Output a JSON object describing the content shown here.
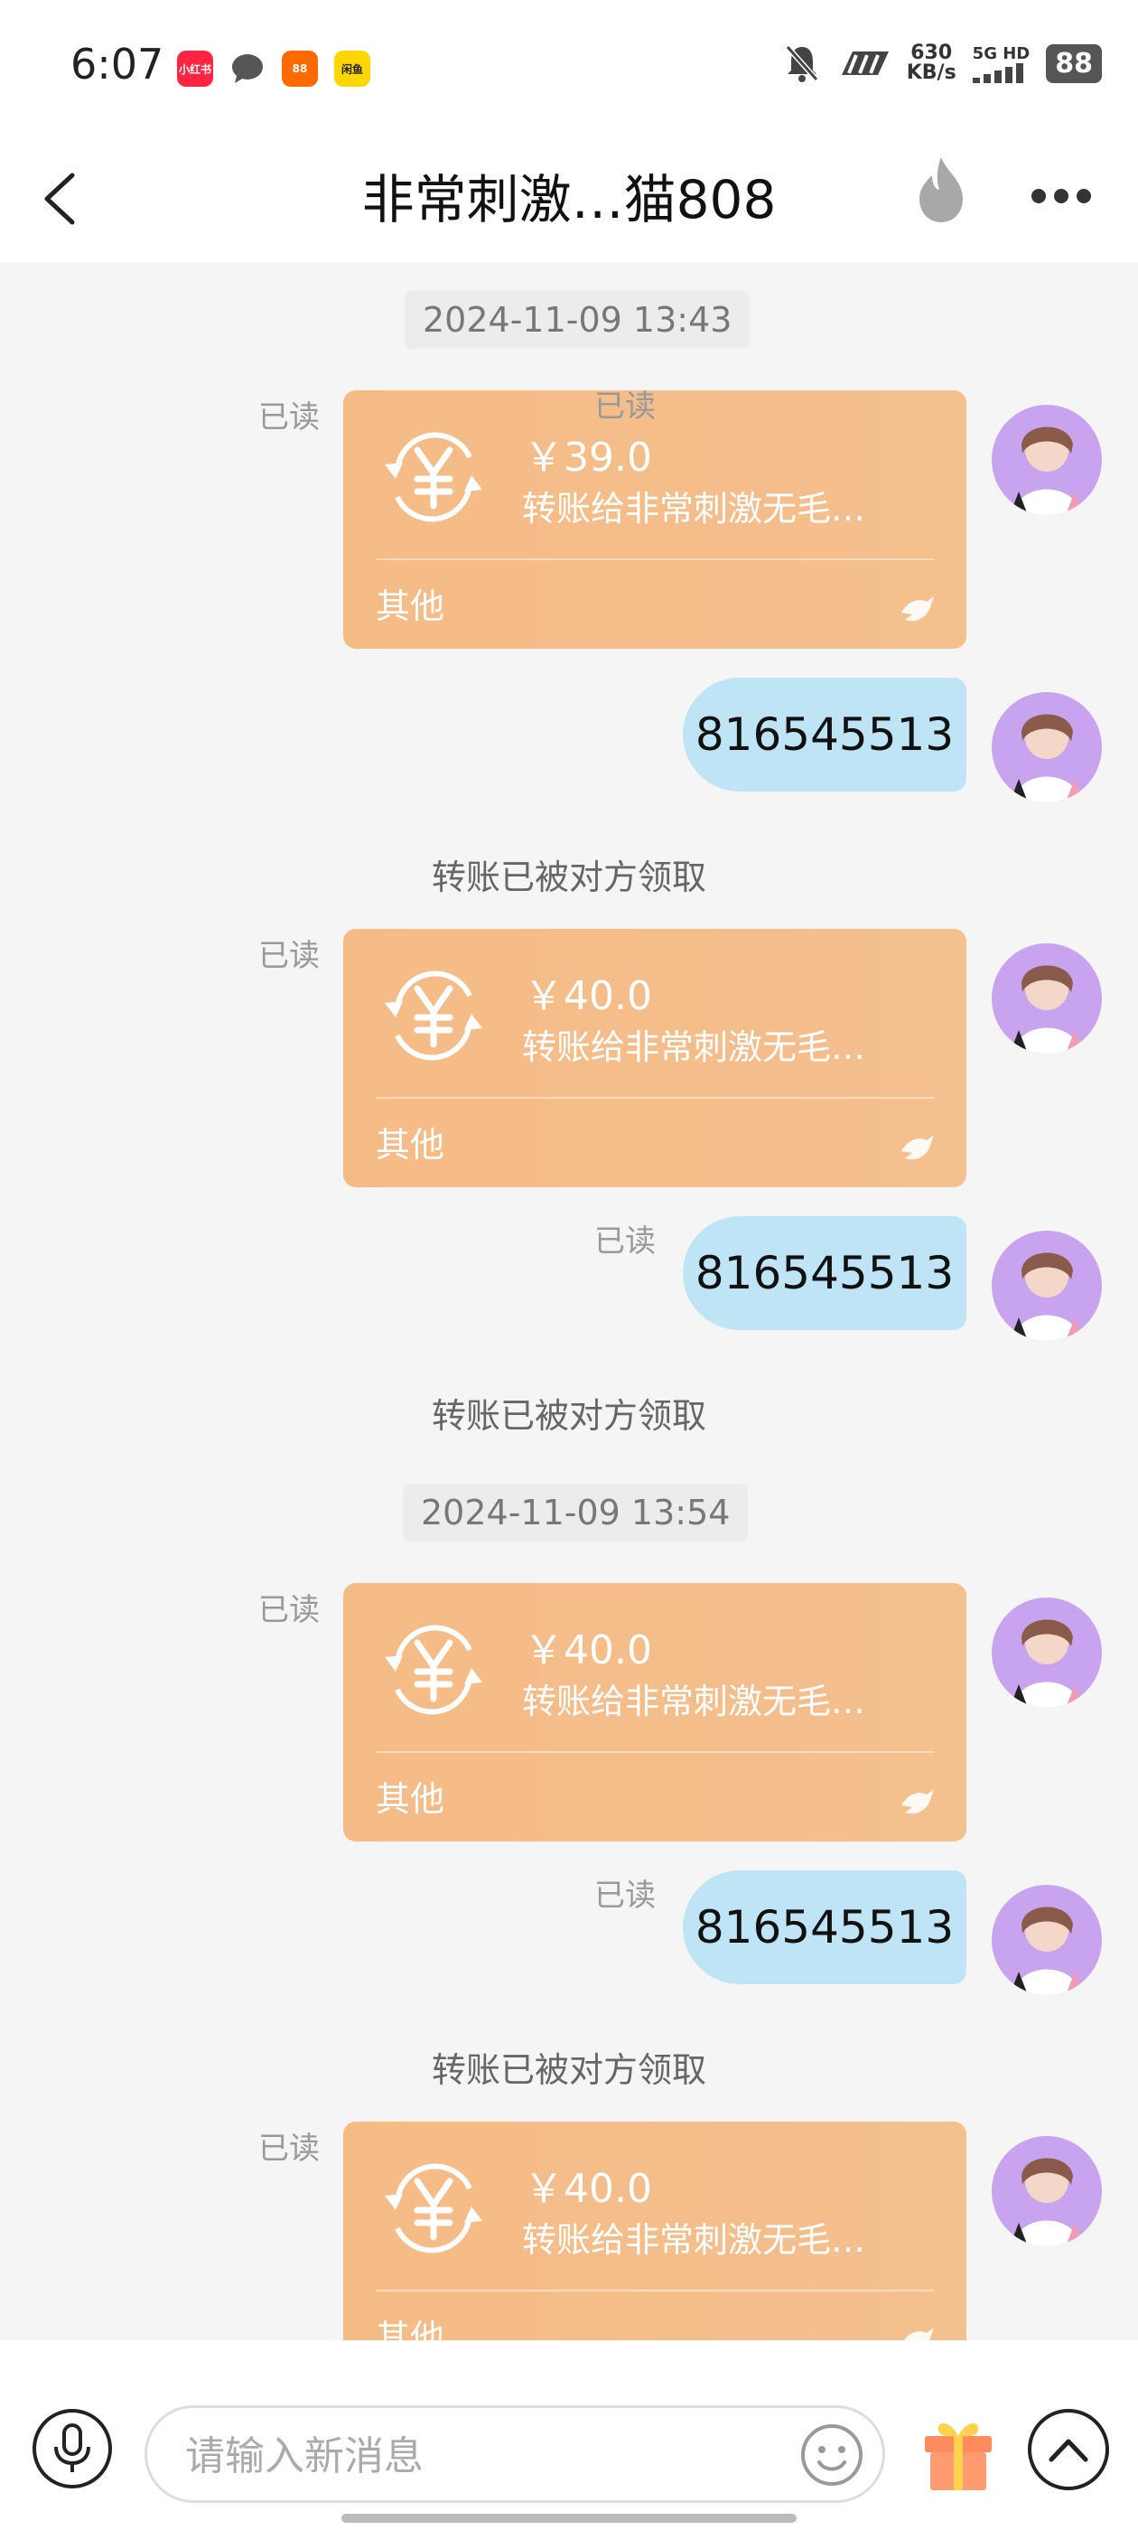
{
  "status_bar": {
    "time": "6:07",
    "apps": [
      {
        "label": "小红书",
        "color": "#ff2442"
      },
      {
        "label": "",
        "color": "#555555"
      },
      {
        "label": "88",
        "color": "#ff6a00"
      },
      {
        "label": "闲鱼",
        "color": "#ffd700"
      }
    ],
    "speed_value": "630",
    "speed_unit": "KB/s",
    "network": "5G HD",
    "battery": "88"
  },
  "header": {
    "title": "非常刺激…猫808"
  },
  "chat": {
    "timestamps": [
      "2024-11-09 13:43",
      "2024-11-09 13:54"
    ],
    "read_label": "已读",
    "transfers": [
      {
        "amount": "￥39.0",
        "desc": "转账给非常刺激无毛…",
        "category": "其他"
      },
      {
        "amount": "￥40.0",
        "desc": "转账给非常刺激无毛…",
        "category": "其他"
      },
      {
        "amount": "￥40.0",
        "desc": "转账给非常刺激无毛…",
        "category": "其他"
      },
      {
        "amount": "￥40.0",
        "desc": "转账给非常刺激无毛…",
        "category": "其他"
      }
    ],
    "messages": [
      "816545513",
      "816545513",
      "816545513"
    ],
    "system_notice": "转账已被对方领取"
  },
  "input": {
    "placeholder": "请输入新消息"
  },
  "colors": {
    "transfer_card": "#f5bb86",
    "sent_bubble": "#bfe4f6",
    "avatar_bg": "#c9a4ee"
  }
}
